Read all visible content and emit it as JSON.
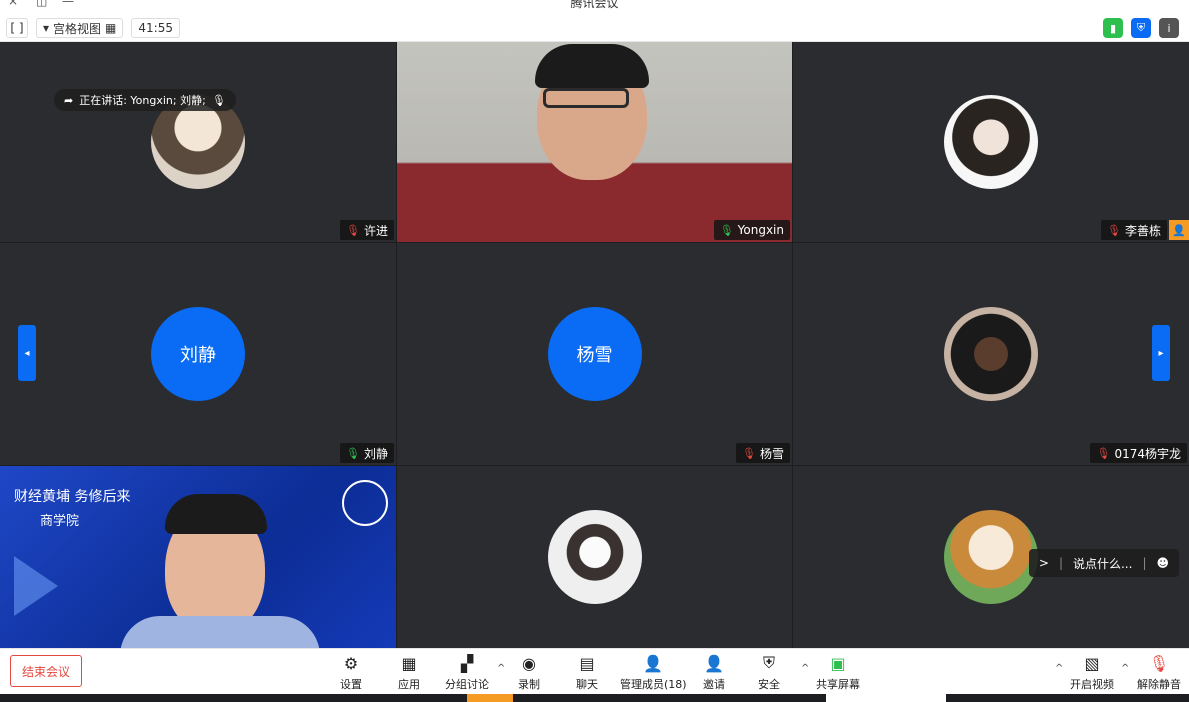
{
  "titlebar": {
    "title": "腾讯会议",
    "close": "×",
    "restore": "◫",
    "minimize": "—"
  },
  "toolbar": {
    "fullscreen_icon": "[ ]",
    "view_label": "宫格视图",
    "dropdown_icon": "▾",
    "timer": "41:55"
  },
  "speaking": {
    "text": "正在讲话: Yongxin; 刘静;"
  },
  "tiles": [
    {
      "name": "许进",
      "mic": "off"
    },
    {
      "name": "Yongxin",
      "mic": "on"
    },
    {
      "name": "李善栋",
      "mic": "off",
      "host": true
    },
    {
      "name": "刘静",
      "avatar_text": "刘静",
      "mic": "on"
    },
    {
      "name": "杨雪",
      "avatar_text": "杨雪",
      "mic": "off"
    },
    {
      "name": "0174杨宇龙",
      "mic": "off"
    },
    {
      "banner": "财经黄埔 务修后来",
      "banner2": "商学院"
    },
    {
      "name": ""
    },
    {
      "name": ""
    }
  ],
  "chat": {
    "placeholder": "说点什么...",
    "send": ">"
  },
  "bottombar": {
    "end_meeting": "结束会议",
    "settings": "设置",
    "apps": "应用",
    "breakout": "分组讨论",
    "record": "录制",
    "chat": "聊天",
    "manage_members": "管理成员(18)",
    "invite": "邀请",
    "security": "安全",
    "share_screen": "共享屏幕",
    "start_video": "开启视频",
    "unmute": "解除静音"
  },
  "colors": {
    "accent": "#0a6cf5",
    "green": "#2ec04f",
    "red": "#e5483f",
    "orange": "#f59a23"
  }
}
